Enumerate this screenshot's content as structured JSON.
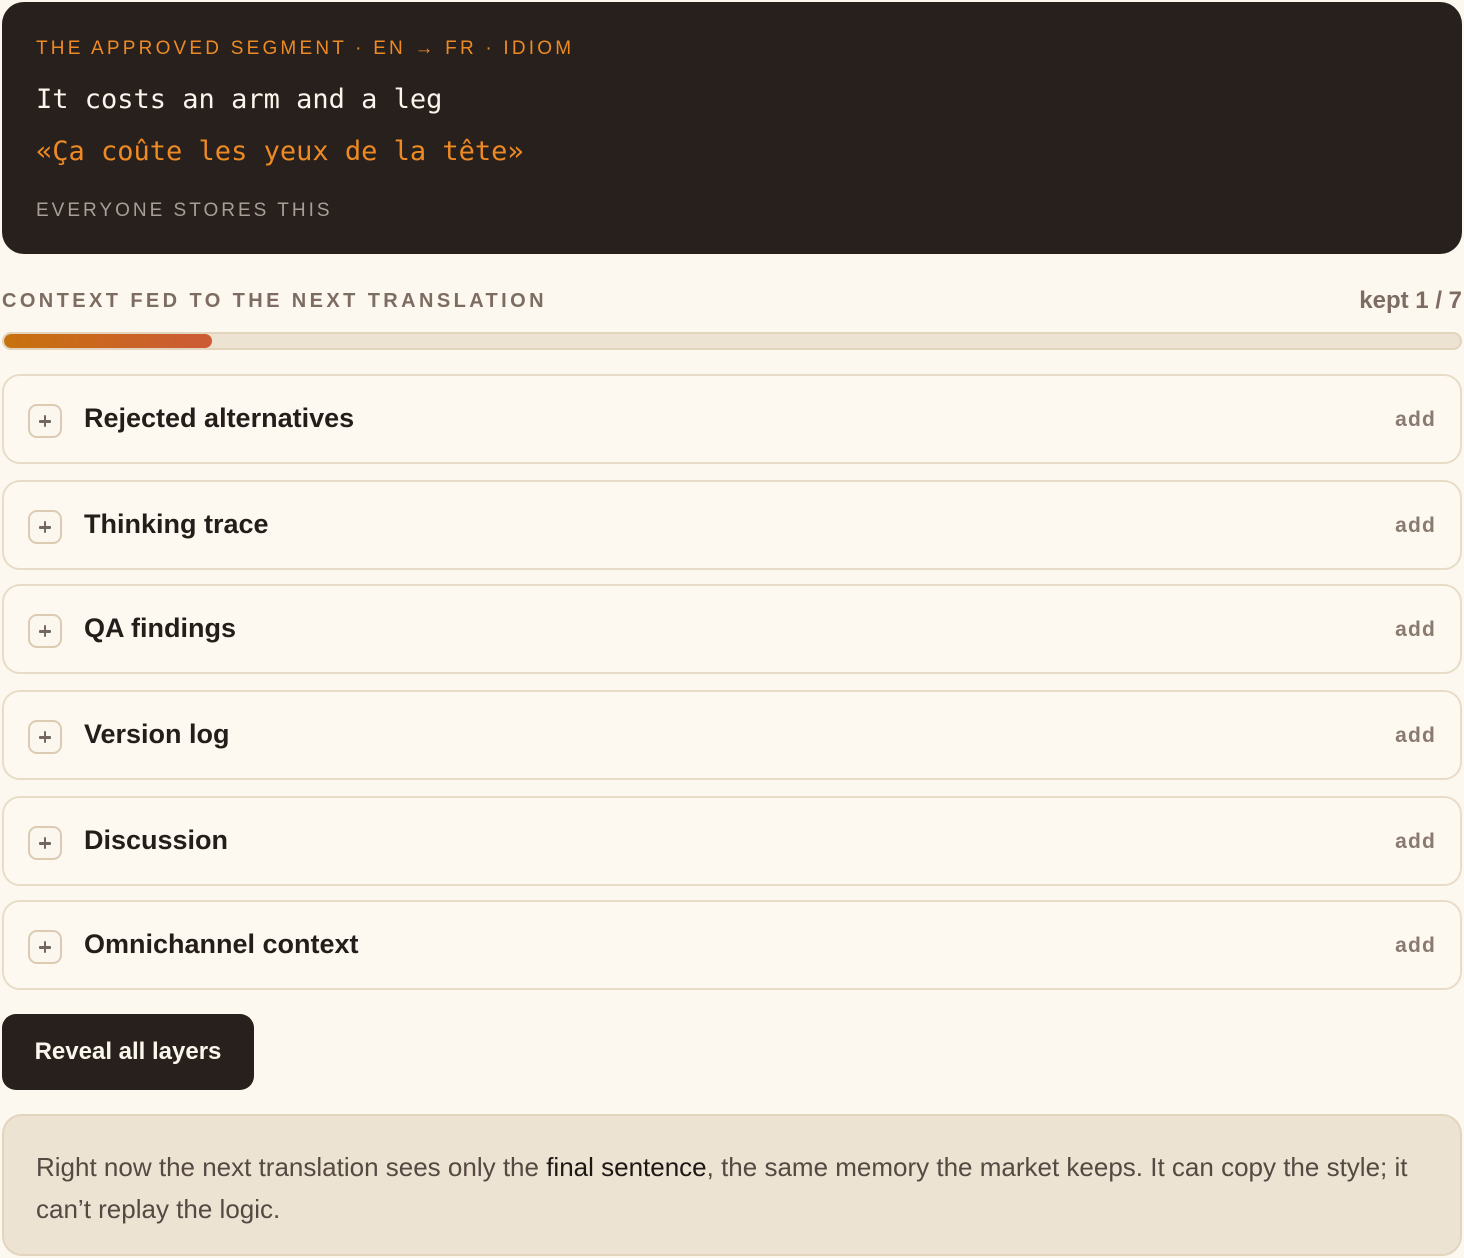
{
  "segment": {
    "eyebrow": "THE APPROVED SEGMENT · EN → FR · IDIOM",
    "source": "It costs an arm and a leg",
    "target": "«Ça coûte les yeux de la tête»",
    "footnote": "EVERYONE STORES THIS"
  },
  "context": {
    "heading": "CONTEXT FED TO THE NEXT TRANSLATION",
    "kept_label": "kept 1 / 7",
    "kept": 1,
    "total": 7
  },
  "layers": [
    {
      "label": "Rejected alternatives",
      "action": "add",
      "icon": "plus-icon"
    },
    {
      "label": "Thinking trace",
      "action": "add",
      "icon": "plus-icon"
    },
    {
      "label": "QA findings",
      "action": "add",
      "icon": "plus-icon"
    },
    {
      "label": "Version log",
      "action": "add",
      "icon": "plus-icon"
    },
    {
      "label": "Discussion",
      "action": "add",
      "icon": "plus-icon"
    },
    {
      "label": "Omnichannel context",
      "action": "add",
      "icon": "plus-icon"
    }
  ],
  "reveal_button": "Reveal all layers",
  "note": {
    "before": "Right now the next translation sees only the ",
    "emphasis": "final sentence",
    "after": ", the same memory the market keeps. It can copy the style; it can’t replay the logic."
  },
  "colors": {
    "accent": "#ee8a24",
    "dark": "#27201d",
    "background": "#fcf8ef"
  }
}
